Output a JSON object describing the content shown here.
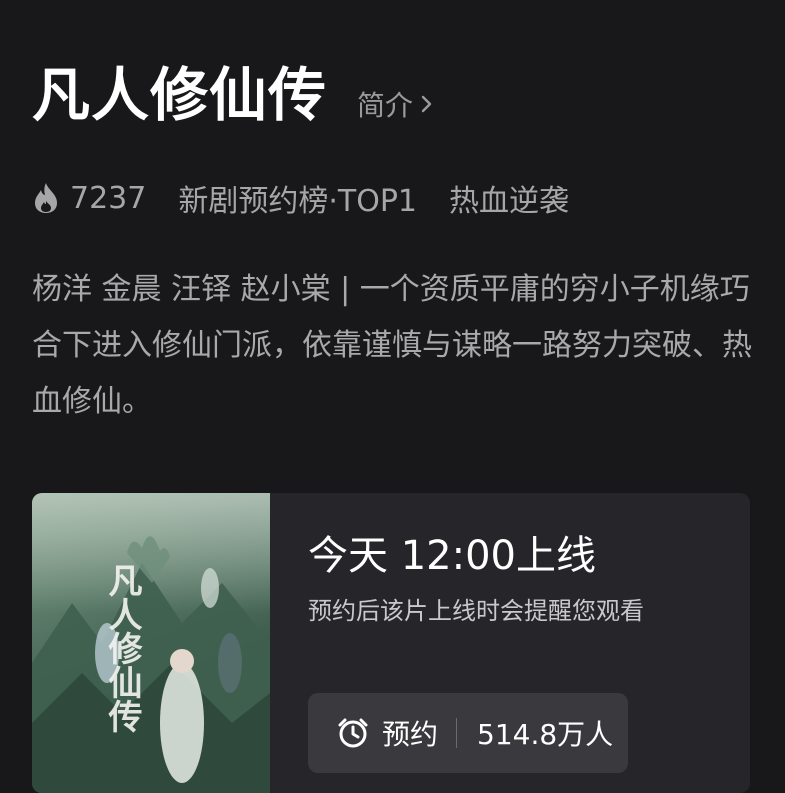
{
  "show": {
    "title": "凡人修仙传",
    "intro_label": "简介"
  },
  "meta": {
    "heat": "7237",
    "rank": "新剧预约榜·TOP1",
    "genre": "热血逆袭"
  },
  "description": "杨洋 金晨 汪铎 赵小棠 | 一个资质平庸的穷小子机缘巧合下进入修仙门派，依靠谨慎与谋略一路努力突破、热血修仙。",
  "release": {
    "title": "今天 12:00上线",
    "subtitle": "预约后该片上线时会提醒您观看",
    "reserve_label": "预约",
    "reserve_count": "514.8万人"
  },
  "poster": {
    "calligraphy": "凡人修仙传"
  },
  "icons": {
    "heat": "flame-icon",
    "intro": "chevron-right-icon",
    "reserve": "alarm-clock-icon"
  }
}
